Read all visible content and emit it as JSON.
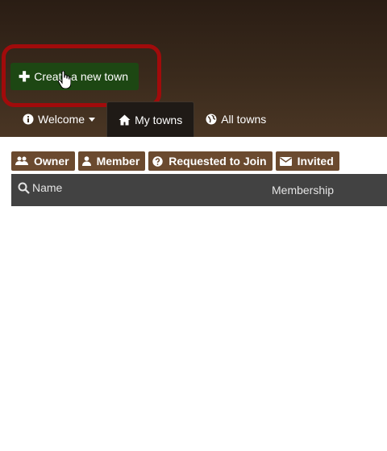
{
  "header": {
    "create_button_label": "Create a new town",
    "create_button_icon": "plus-icon",
    "highlight_color": "#a10b0b"
  },
  "tabs": [
    {
      "label": "Welcome",
      "icon": "info-circle-icon",
      "dropdown": true,
      "active": false
    },
    {
      "label": "My towns",
      "icon": "home-icon",
      "active": true
    },
    {
      "label": "All towns",
      "icon": "globe-icon",
      "active": false
    }
  ],
  "filters": [
    {
      "label": "Owner",
      "icon": "users-icon"
    },
    {
      "label": "Member",
      "icon": "user-icon"
    },
    {
      "label": "Requested to Join",
      "icon": "question-circle-icon"
    },
    {
      "label": "Invited",
      "icon": "envelope-icon"
    }
  ],
  "table": {
    "columns": [
      {
        "label": "Name",
        "icon": "search-icon"
      },
      {
        "label": "Membership"
      }
    ],
    "rows": []
  },
  "colors": {
    "header_bg": "#3a2a1c",
    "create_button_bg": "#1d4713",
    "filter_bg": "#6b4a2f",
    "table_header_bg": "#424242"
  }
}
